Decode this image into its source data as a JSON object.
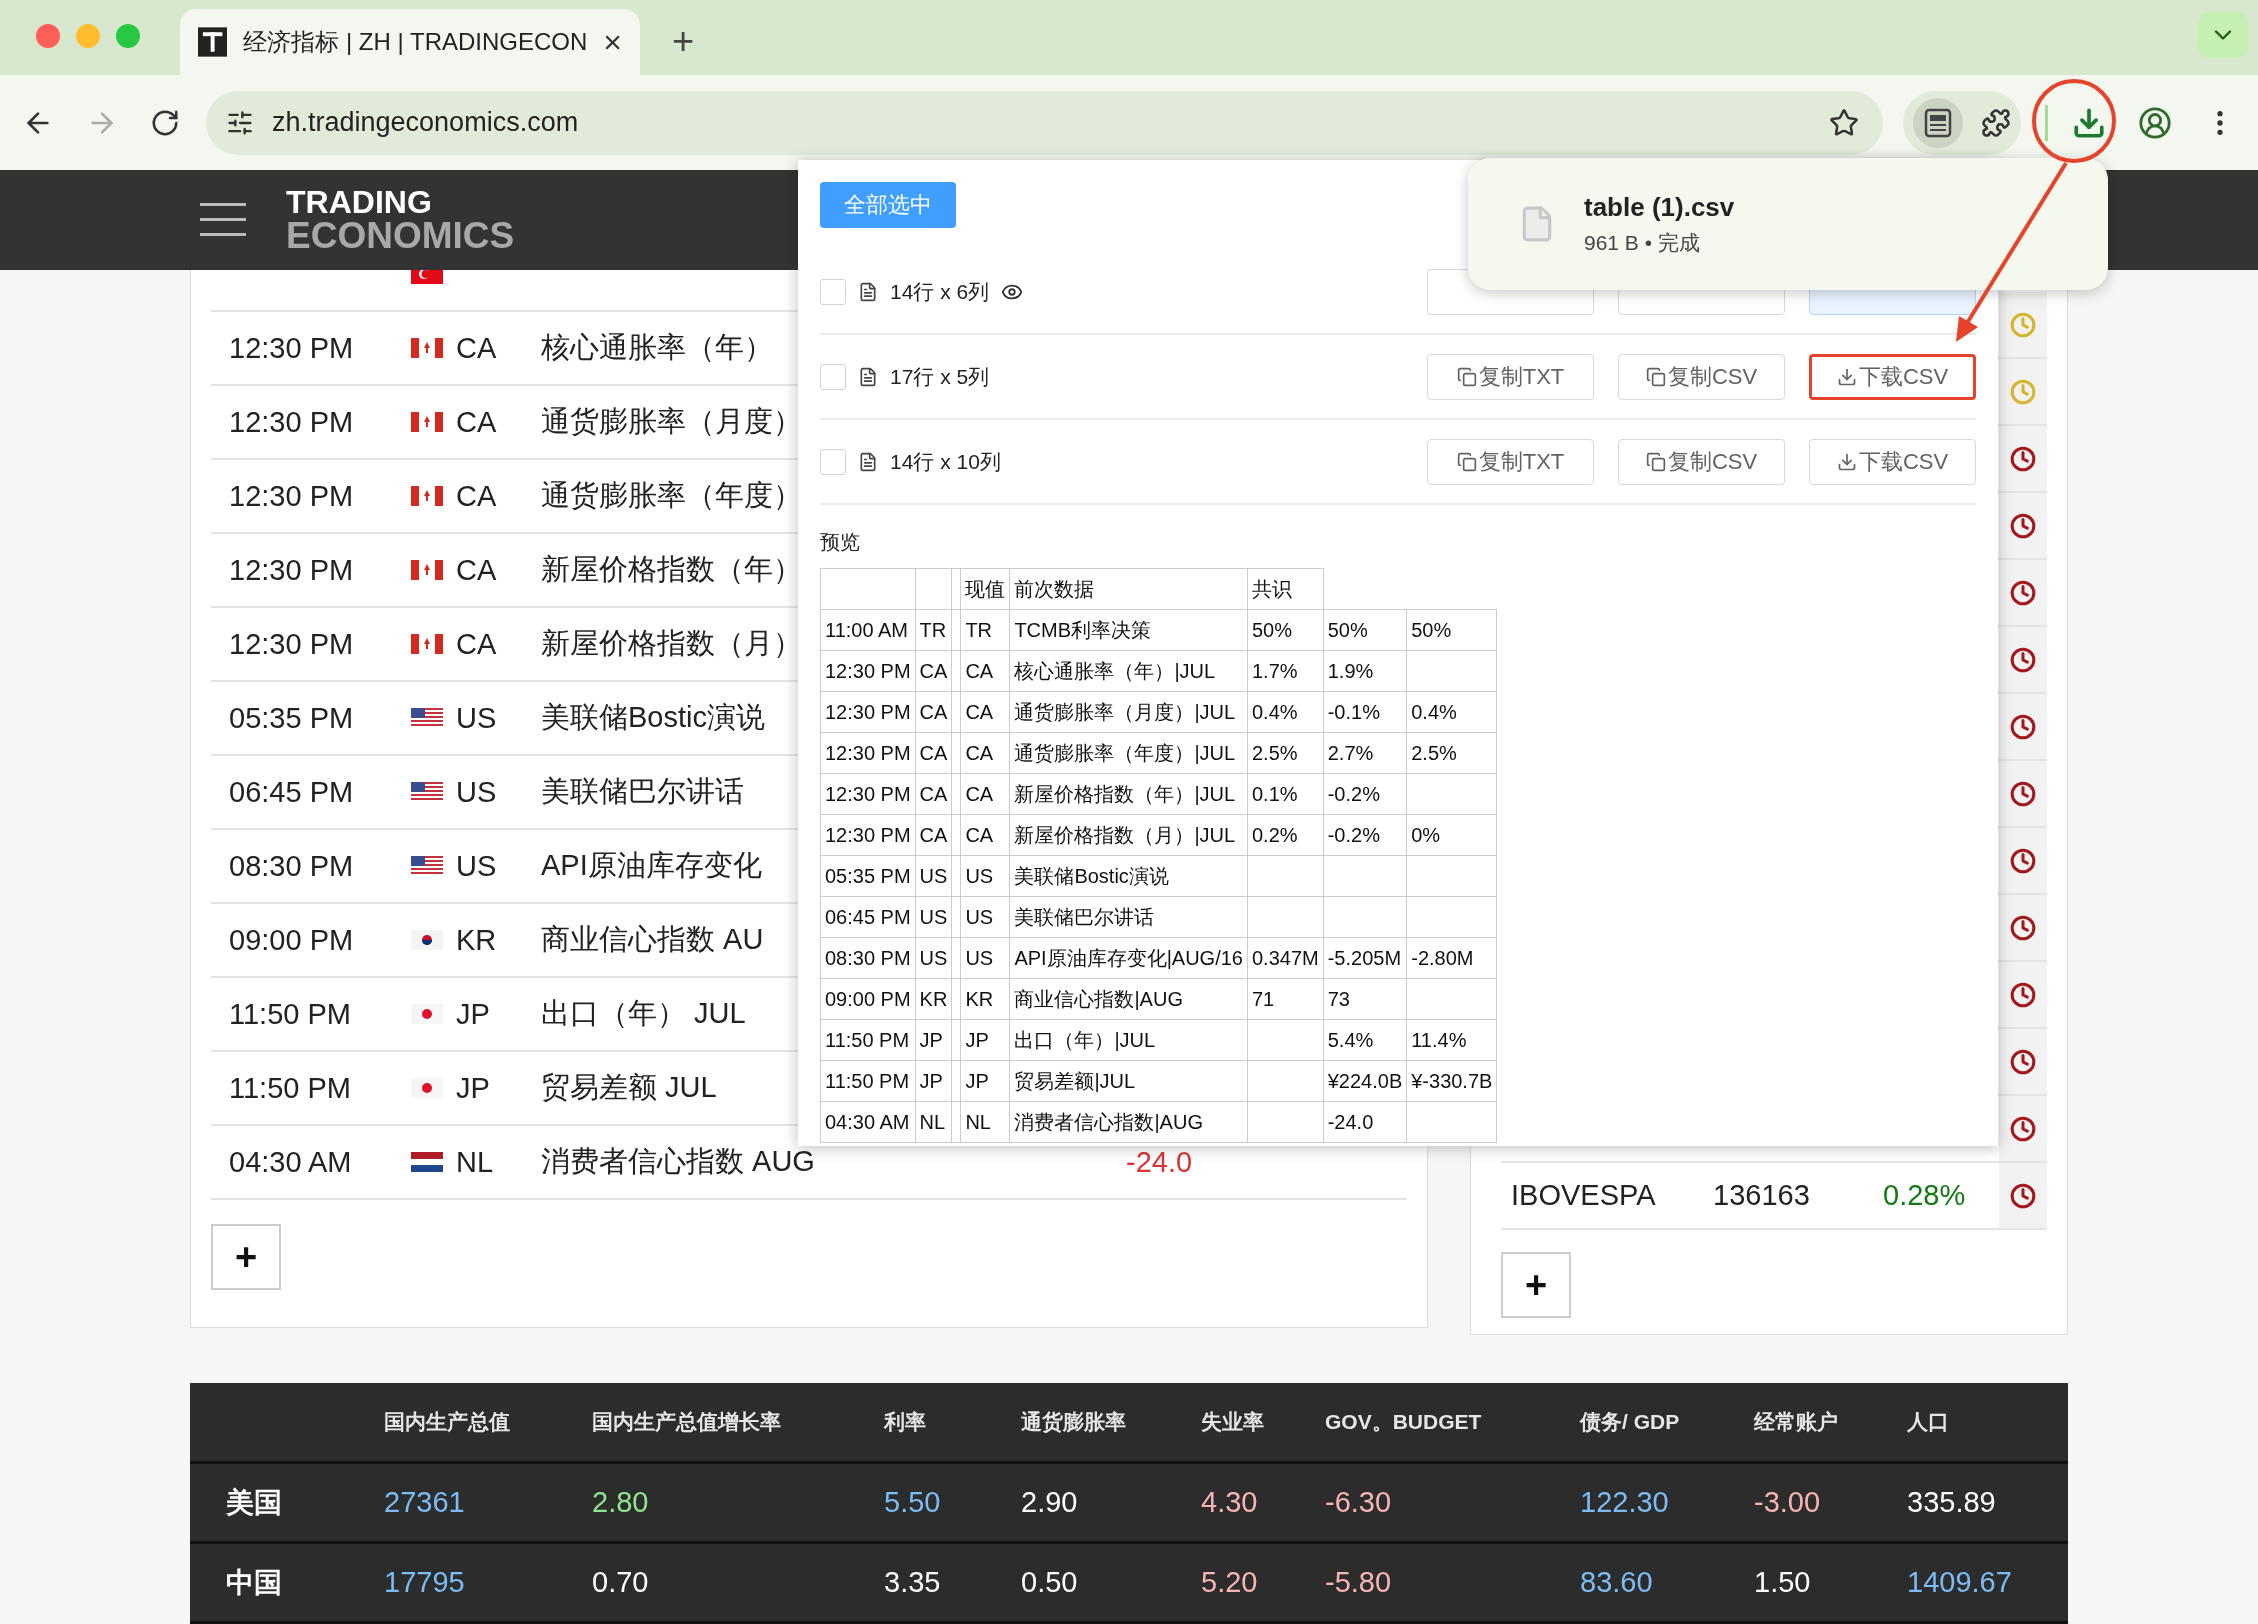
{
  "browser": {
    "tab": {
      "title": "经济指标 | ZH | TRADINGECON",
      "close": "×"
    },
    "new_tab": "+",
    "address": {
      "url": "zh.tradingeconomics.com"
    }
  },
  "site_header": {
    "logo": {
      "line_1": "TRADING",
      "line_2": "ECONOMICS"
    }
  },
  "calendar": {
    "rows": [
      {
        "kind": "tr"
      },
      {
        "time": "12:30 PM",
        "kind": "ca",
        "country": "CA",
        "event": "核心通胀率（年）"
      },
      {
        "time": "12:30 PM",
        "kind": "ca",
        "country": "CA",
        "event": "通货膨胀率（月度）"
      },
      {
        "time": "12:30 PM",
        "kind": "ca",
        "country": "CA",
        "event": "通货膨胀率（年度）"
      },
      {
        "time": "12:30 PM",
        "kind": "ca",
        "country": "CA",
        "event": "新屋价格指数（年）"
      },
      {
        "time": "12:30 PM",
        "kind": "ca",
        "country": "CA",
        "event": "新屋价格指数（月）"
      },
      {
        "time": "05:35 PM",
        "kind": "us",
        "country": "US",
        "event": "美联储Bostic演说"
      },
      {
        "time": "06:45 PM",
        "kind": "us",
        "country": "US",
        "event": "美联储巴尔讲话"
      },
      {
        "time": "08:30 PM",
        "kind": "us",
        "country": "US",
        "event": "API原油库存变化"
      },
      {
        "time": "09:00 PM",
        "kind": "kr",
        "country": "KR",
        "event": "商业信心指数 AU"
      },
      {
        "time": "11:50 PM",
        "kind": "jp",
        "country": "JP",
        "event": "出口（年） JUL"
      },
      {
        "time": "11:50 PM",
        "kind": "jp",
        "country": "JP",
        "event": "贸易差额 JUL"
      },
      {
        "time": "04:30 AM",
        "kind": "nl",
        "country": "NL",
        "event": "消费者信心指数 AUG",
        "actual": "-24.0"
      }
    ],
    "add_button": "+"
  },
  "markets": {
    "rows": [
      {
        "color": "#d4b52c"
      },
      {
        "color": "#d4b52c"
      },
      {
        "color": "#a3181c"
      },
      {
        "color": "#a3181c"
      },
      {
        "color": "#a3181c"
      },
      {
        "color": "#a3181c"
      },
      {
        "color": "#a3181c"
      },
      {
        "color": "#a3181c"
      },
      {
        "color": "#a3181c"
      },
      {
        "color": "#a3181c"
      },
      {
        "color": "#a3181c"
      },
      {
        "color": "#a3181c"
      },
      {
        "color": "#a3181c"
      },
      {
        "name": "IBOVESPA",
        "price": "136163",
        "change": "0.28%",
        "color": "#a3181c"
      }
    ],
    "add_button": "+"
  },
  "indicators": {
    "columns": [
      "国内生产总值",
      "国内生产总值增长率",
      "利率",
      "通货膨胀率",
      "失业率",
      "GOV。BUDGET",
      "债务/ GDP",
      "经常账户",
      "人口"
    ],
    "rows": [
      {
        "country": "美国",
        "cells": [
          {
            "value": "27361",
            "color": "#7cbcf6"
          },
          {
            "value": "2.80",
            "color": "#8fe48f"
          },
          {
            "value": "5.50",
            "color": "#7cbcf6"
          },
          {
            "value": "2.90",
            "color": "#ffffff"
          },
          {
            "value": "4.30",
            "color": "#f7b4b4"
          },
          {
            "value": "-6.30",
            "color": "#f7b4b4"
          },
          {
            "value": "122.30",
            "color": "#7cbcf6"
          },
          {
            "value": "-3.00",
            "color": "#f7b4b4"
          },
          {
            "value": "335.89",
            "color": "#ffffff"
          }
        ]
      },
      {
        "country": "中国",
        "cells": [
          {
            "value": "17795",
            "color": "#7cbcf6"
          },
          {
            "value": "0.70",
            "color": "#ffffff"
          },
          {
            "value": "3.35",
            "color": "#ffffff"
          },
          {
            "value": "0.50",
            "color": "#ffffff"
          },
          {
            "value": "5.20",
            "color": "#f7b4b4"
          },
          {
            "value": "-5.80",
            "color": "#f7b4b4"
          },
          {
            "value": "83.60",
            "color": "#7cbcf6"
          },
          {
            "value": "1.50",
            "color": "#ffffff"
          },
          {
            "value": "1409.67",
            "color": "#7cbcf6"
          }
        ]
      }
    ]
  },
  "extension_popup": {
    "select_all_button": "全部选中",
    "tables": [
      {
        "label": "14行 x 6列",
        "checked": false,
        "previewing": true,
        "buttons": [
          {
            "kind": "copy",
            "highlighted": false,
            "annotated": false
          },
          {
            "kind": "copy",
            "highlighted": false,
            "annotated": false
          },
          {
            "kind": "download",
            "highlighted": true,
            "annotated": false
          }
        ]
      },
      {
        "label": "17行 x 5列",
        "checked": false,
        "previewing": false,
        "buttons": [
          {
            "kind": "copy",
            "label": "复制TXT",
            "highlighted": false,
            "annotated": false
          },
          {
            "kind": "copy",
            "label": "复制CSV",
            "highlighted": false,
            "annotated": false
          },
          {
            "kind": "download",
            "label": "下载CSV",
            "highlighted": false,
            "annotated": true
          }
        ]
      },
      {
        "label": "14行 x 10列",
        "checked": false,
        "previewing": false,
        "buttons": [
          {
            "kind": "copy",
            "label": "复制TXT",
            "highlighted": false,
            "annotated": false
          },
          {
            "kind": "copy",
            "label": "复制CSV",
            "highlighted": false,
            "annotated": false
          },
          {
            "kind": "download",
            "label": "下载CSV",
            "highlighted": false,
            "annotated": false
          }
        ]
      }
    ],
    "preview": {
      "label": "预览",
      "header": {
        "actual": "现值",
        "previous": "前次数据",
        "consensus": "共识"
      },
      "rows": [
        {
          "time": "11:00 AM",
          "country": "TR",
          "code": "TR",
          "event": "TCMB利率决策",
          "actual": "50%",
          "previous": "50%",
          "consensus": "50%"
        },
        {
          "time": "12:30 PM",
          "country": "CA",
          "code": "CA",
          "event": "核心通胀率（年）|JUL",
          "actual": "1.7%",
          "previous": "1.9%"
        },
        {
          "time": "12:30 PM",
          "country": "CA",
          "code": "CA",
          "event": "通货膨胀率（月度）|JUL",
          "actual": "0.4%",
          "previous": "-0.1%",
          "consensus": "0.4%"
        },
        {
          "time": "12:30 PM",
          "country": "CA",
          "code": "CA",
          "event": "通货膨胀率（年度）|JUL",
          "actual": "2.5%",
          "previous": "2.7%",
          "consensus": "2.5%"
        },
        {
          "time": "12:30 PM",
          "country": "CA",
          "code": "CA",
          "event": "新屋价格指数（年）|JUL",
          "actual": "0.1%",
          "previous": "-0.2%"
        },
        {
          "time": "12:30 PM",
          "country": "CA",
          "code": "CA",
          "event": "新屋价格指数（月）|JUL",
          "actual": "0.2%",
          "previous": "-0.2%",
          "consensus": "0%"
        },
        {
          "time": "05:35 PM",
          "country": "US",
          "code": "US",
          "event": "美联储Bostic演说"
        },
        {
          "time": "06:45 PM",
          "country": "US",
          "code": "US",
          "event": "美联储巴尔讲话"
        },
        {
          "time": "08:30 PM",
          "country": "US",
          "code": "US",
          "event": "API原油库存变化|AUG/16",
          "actual": "0.347M",
          "previous": "-5.205M",
          "consensus": "-2.80M"
        },
        {
          "time": "09:00 PM",
          "country": "KR",
          "code": "KR",
          "event": "商业信心指数|AUG",
          "actual": "71",
          "previous": "73"
        },
        {
          "time": "11:50 PM",
          "country": "JP",
          "code": "JP",
          "event": "出口（年）|JUL",
          "previous": "5.4%",
          "consensus": "11.4%"
        },
        {
          "time": "11:50 PM",
          "country": "JP",
          "code": "JP",
          "event": "贸易差额|JUL",
          "previous": "¥224.0B",
          "consensus": "¥-330.7B"
        },
        {
          "time": "04:30 AM",
          "country": "NL",
          "code": "NL",
          "event": "消费者信心指数|AUG",
          "previous": "-24.0"
        }
      ]
    }
  },
  "download_bubble": {
    "file_name": "table (1).csv",
    "detail": "961 B • 完成"
  }
}
